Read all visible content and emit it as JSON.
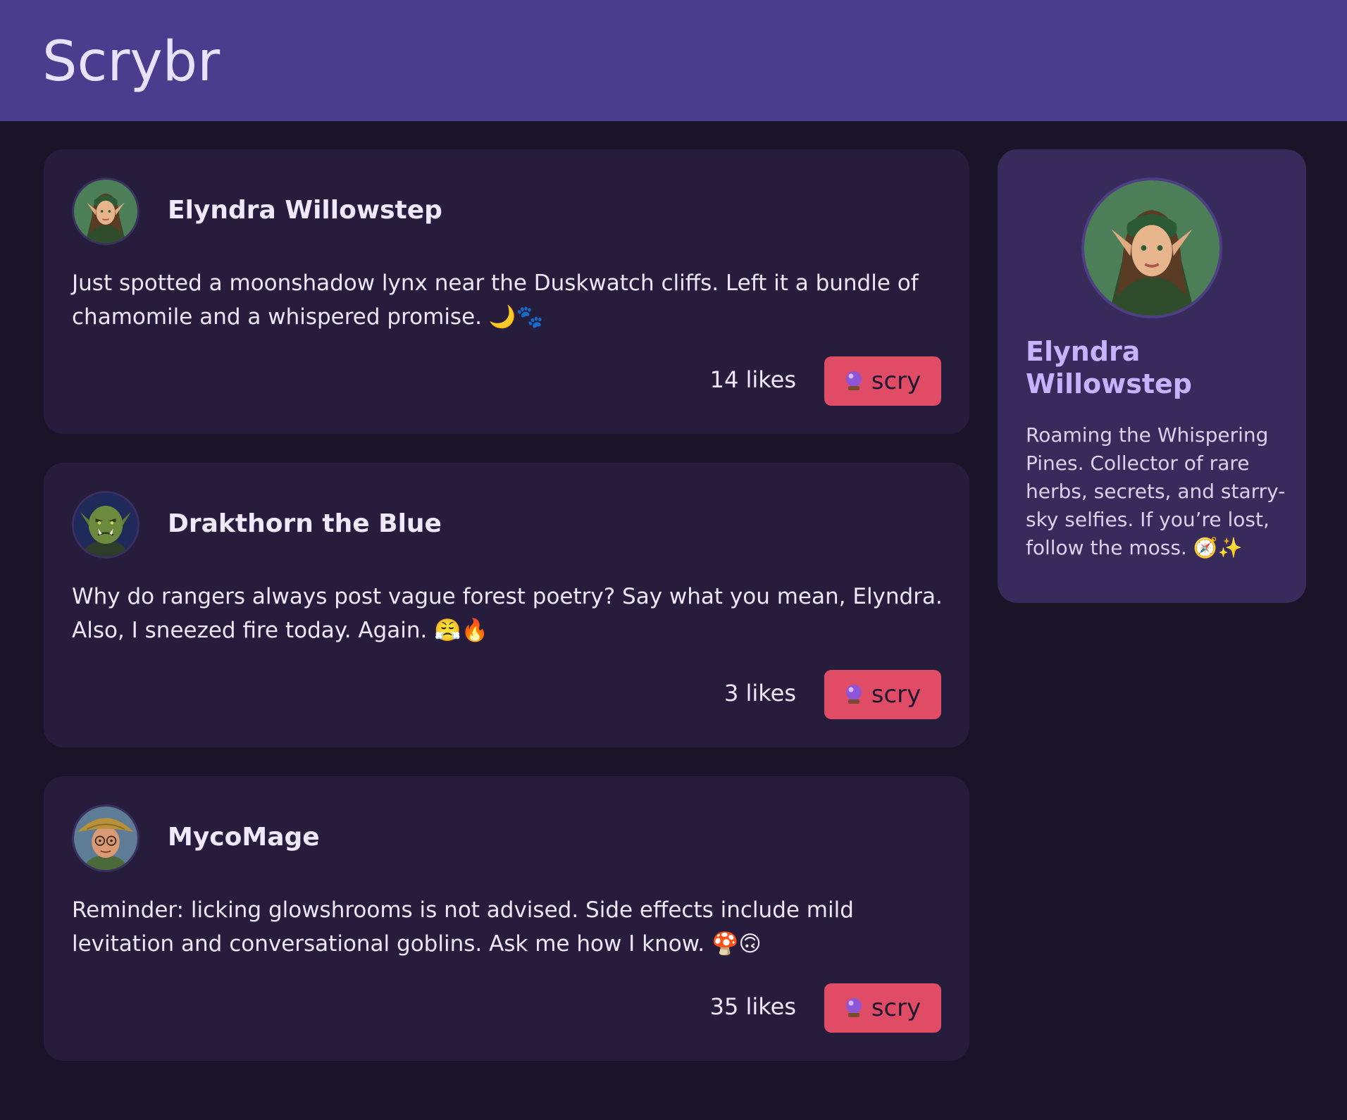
{
  "app": {
    "title": "Scrybr"
  },
  "colors": {
    "header_bg": "#4a3d8d",
    "page_bg": "#1a1429",
    "card_bg": "#261d3d",
    "profile_bg": "#372b5c",
    "accent_button": "#e04c66",
    "profile_name": "#c4b3ff"
  },
  "posts": [
    {
      "author": "Elyndra Willowstep",
      "avatar_icon": "elf-avatar-icon",
      "body": "Just spotted a moonshadow lynx near the Duskwatch cliffs. Left it a bundle of chamomile and a whispered promise. 🌙🐾",
      "likes": "14 likes",
      "action_icon": "crystal-ball-icon",
      "action_label": "scry"
    },
    {
      "author": "Drakthorn the Blue",
      "avatar_icon": "orc-avatar-icon",
      "body": "Why do rangers always post vague forest poetry? Say what you mean, Elyndra. Also, I sneezed fire today. Again. 😤🔥",
      "likes": "3 likes",
      "action_icon": "crystal-ball-icon",
      "action_label": "scry"
    },
    {
      "author": "MycoMage",
      "avatar_icon": "mushroom-mage-avatar-icon",
      "body": "Reminder: licking glowshrooms is not advised. Side effects include mild levitation and conversational goblins. Ask me how I know. 🍄🙃",
      "likes": "35 likes",
      "action_icon": "crystal-ball-icon",
      "action_label": "scry"
    }
  ],
  "profile": {
    "name": "Elyndra Willowstep",
    "avatar_icon": "elf-avatar-icon",
    "bio": "Roaming the Whispering Pines. Collector of rare herbs, secrets, and starry-sky selfies. If you’re lost, follow the moss. 🧭✨"
  }
}
